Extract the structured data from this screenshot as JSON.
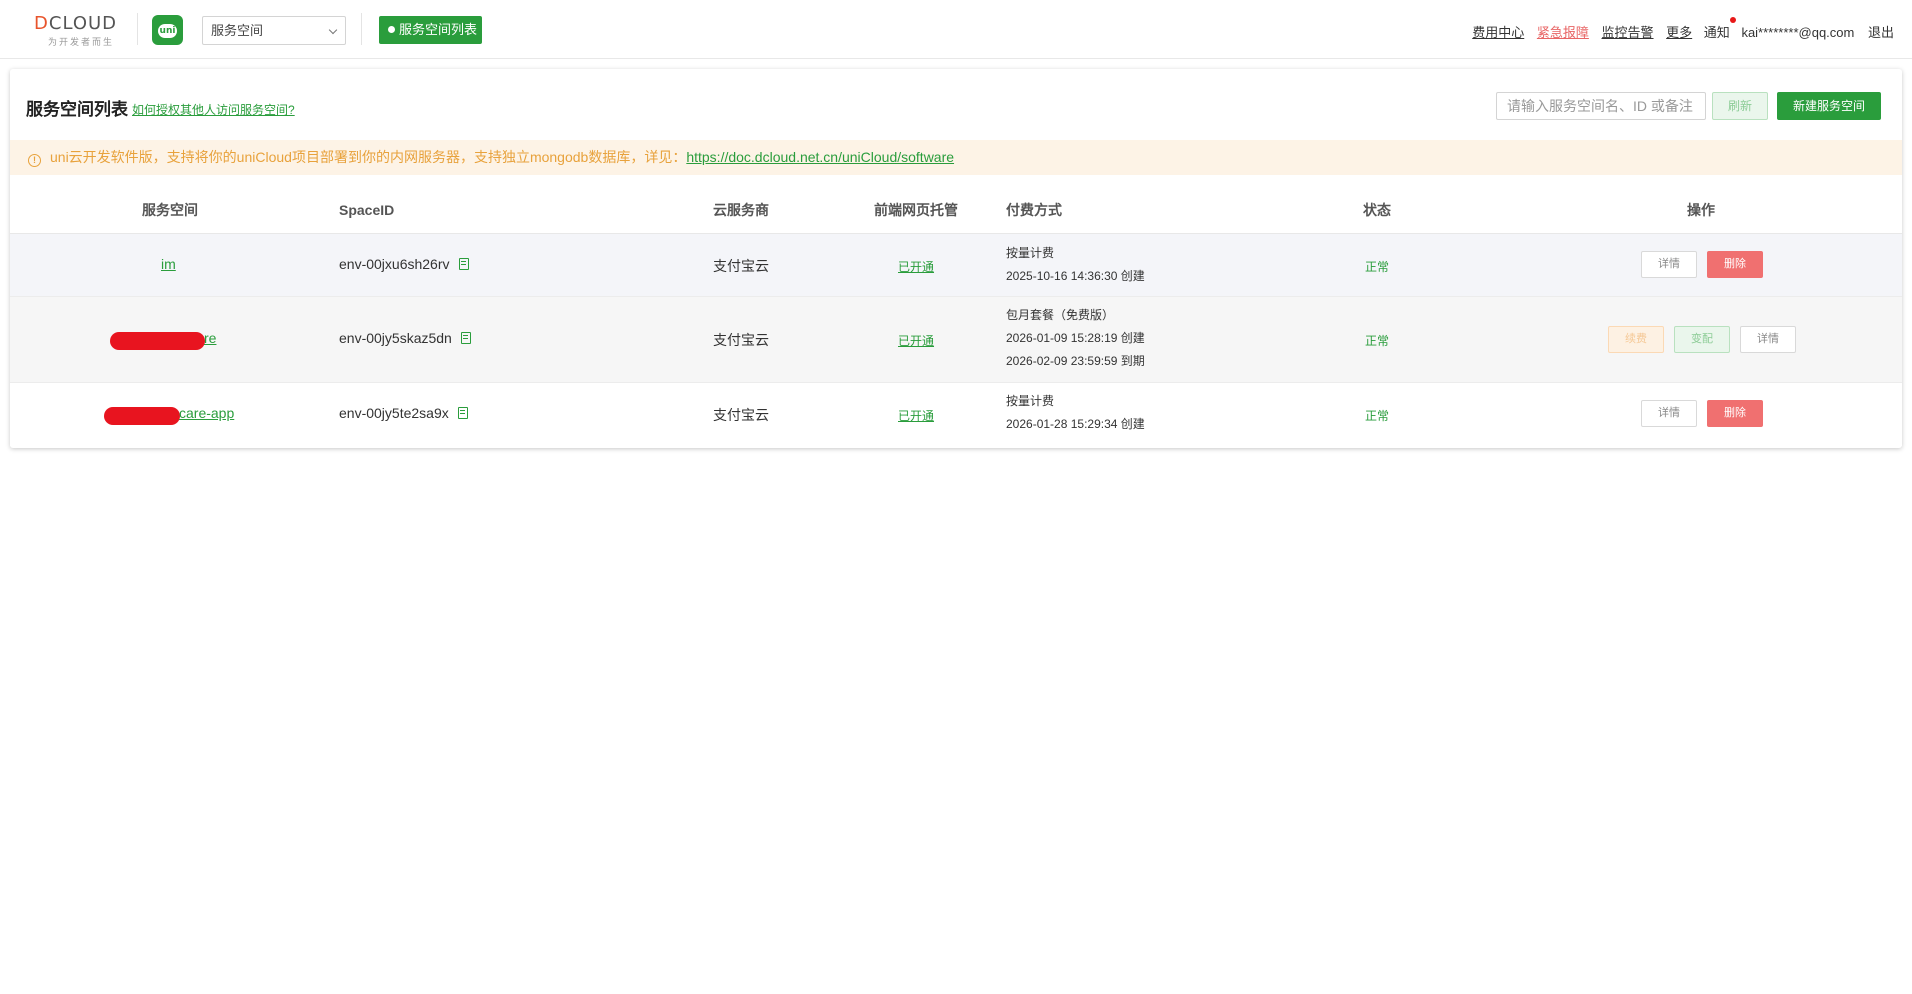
{
  "header": {
    "logo_text": "DCLOUD",
    "logo_subtitle": "为开发者而生",
    "uni_icon_label": "uni",
    "space_select_value": "服务空间",
    "breadcrumb_active": "服务空间列表",
    "nav": {
      "billing": "费用中心",
      "emergency": "紧急报障",
      "monitor": "监控告警",
      "more": "更多",
      "notify": "通知",
      "user_email": "kai********@qq.com",
      "logout": "退出"
    }
  },
  "card": {
    "title": "服务空间列表",
    "help_link": "如何授权其他人访问服务空间?",
    "search_placeholder": "请输入服务空间名、ID 或备注",
    "refresh_label": "刷新",
    "new_label": "新建服务空间"
  },
  "notice": {
    "text": "uni云开发软件版，支持将你的uniCloud项目部署到你的内网服务器，支持独立mongodb数据库，详见：",
    "link": "https://doc.dcloud.net.cn/uniCloud/software"
  },
  "table": {
    "headers": {
      "space": "服务空间",
      "space_id": "SpaceID",
      "provider": "云服务商",
      "hosting": "前端网页托管",
      "payment": "付费方式",
      "status": "状态",
      "actions": "操作"
    },
    "rows": [
      {
        "name": "im",
        "space_id": "env-00jxu6sh26rv",
        "provider": "支付宝云",
        "hosting": "已开通",
        "pay_type": "按量计费",
        "created": "2025-10-16 14:36:30 创建",
        "status": "正常",
        "detail": "详情",
        "delete": "删除"
      },
      {
        "name": "re",
        "space_id": "env-00jy5skaz5dn",
        "provider": "支付宝云",
        "hosting": "已开通",
        "pay_type": "包月套餐（免费版）",
        "created": "2026-01-09 15:28:19 创建",
        "expires": "2026-02-09 23:59:59 到期",
        "status": "正常",
        "renew": "续费",
        "change": "变配",
        "detail": "详情"
      },
      {
        "name": "care-app",
        "space_id": "env-00jy5te2sa9x",
        "provider": "支付宝云",
        "hosting": "已开通",
        "pay_type": "按量计费",
        "created": "2026-01-28 15:29:34 创建",
        "status": "正常",
        "detail": "详情",
        "delete": "删除"
      }
    ]
  },
  "colors": {
    "accent": "#2a9d3c",
    "danger": "#f07070",
    "warning_text": "#e8a23c",
    "notice_bg": "#fdf3e6"
  }
}
